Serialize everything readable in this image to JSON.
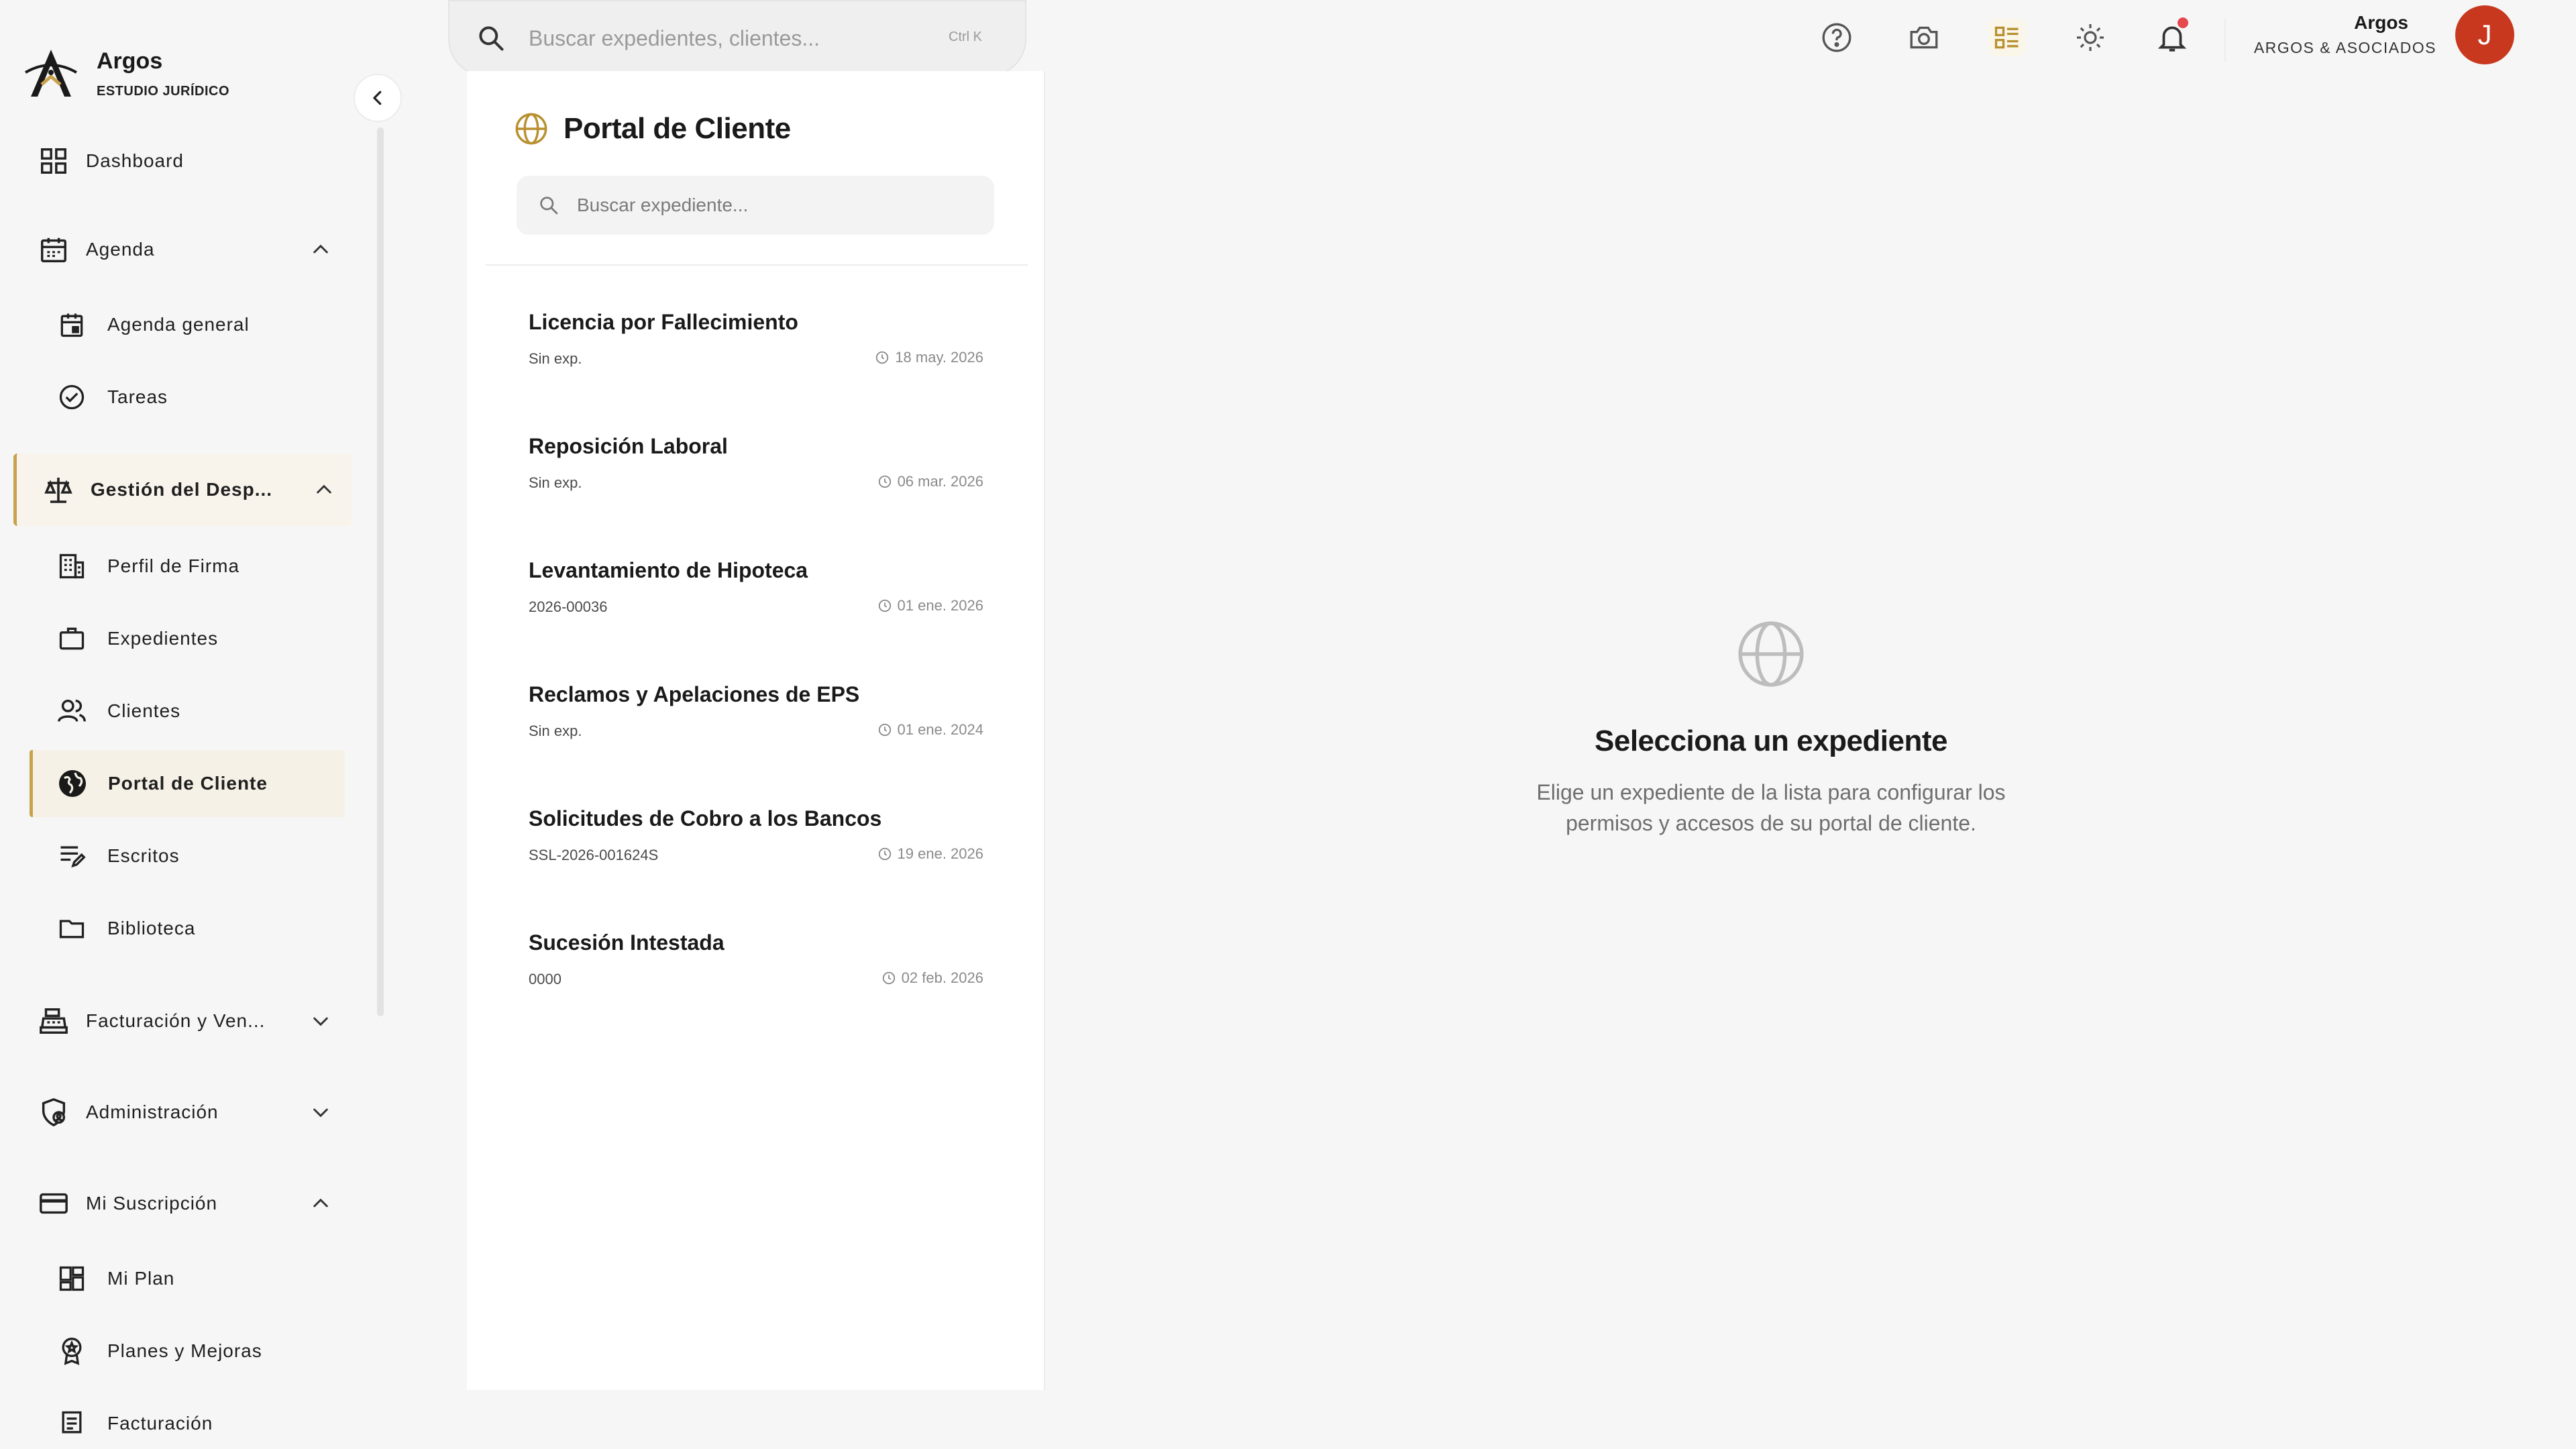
{
  "brand": {
    "name": "Argos",
    "subtitle": "ESTUDIO JURÍDICO"
  },
  "topbar": {
    "search_placeholder": "Buscar expedientes, clientes...",
    "shortcut": "Ctrl K",
    "user_name": "Argos",
    "user_org": "ARGOS & ASOCIADOS",
    "avatar_initial": "J"
  },
  "sidebar": {
    "dashboard": "Dashboard",
    "agenda": "Agenda",
    "agenda_general": "Agenda general",
    "tareas": "Tareas",
    "gestion": "Gestión del Desp...",
    "perfil_firma": "Perfil de Firma",
    "expedientes": "Expedientes",
    "clientes": "Clientes",
    "portal_cliente": "Portal de Cliente",
    "escritos": "Escritos",
    "biblioteca": "Biblioteca",
    "facturacion_ventas": "Facturación y Ven...",
    "administracion": "Administración",
    "mi_suscripcion": "Mi Suscripción",
    "mi_plan": "Mi Plan",
    "planes_mejoras": "Planes y Mejoras",
    "facturacion": "Facturación"
  },
  "portal": {
    "title": "Portal de Cliente",
    "search_placeholder": "Buscar expediente...",
    "cases": [
      {
        "title": "Licencia por Fallecimiento",
        "number": "Sin exp.",
        "date": "18 may. 2026"
      },
      {
        "title": "Reposición Laboral",
        "number": "Sin exp.",
        "date": "06 mar. 2026"
      },
      {
        "title": "Levantamiento de Hipoteca",
        "number": "2026-00036",
        "date": "01 ene. 2026"
      },
      {
        "title": "Reclamos y Apelaciones de EPS",
        "number": "Sin exp.",
        "date": "01 ene. 2024"
      },
      {
        "title": "Solicitudes de Cobro a los Bancos",
        "number": "SSL-2026-001624S",
        "date": "19 ene. 2026"
      },
      {
        "title": "Sucesión Intestada",
        "number": "0000",
        "date": "02 feb. 2026"
      }
    ]
  },
  "empty_state": {
    "title": "Selecciona un expediente",
    "description": "Elige un expediente de la lista para configurar los permisos y accesos de su portal de cliente."
  },
  "colors": {
    "accent": "#c9a24f",
    "avatar": "#c8381e",
    "notification": "#e5484d"
  }
}
